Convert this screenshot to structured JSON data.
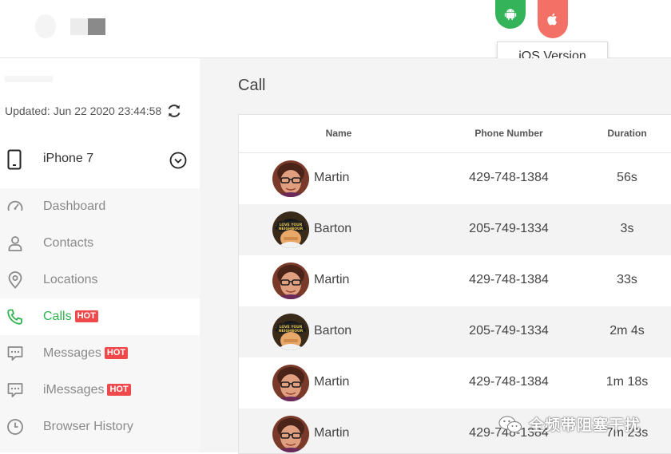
{
  "header": {
    "os_tabs": [
      {
        "name": "android",
        "color": "#34b35a",
        "icon": "android-icon"
      },
      {
        "name": "ios",
        "color": "#f27066",
        "icon": "apple-icon"
      }
    ],
    "tooltip": "iOS Version"
  },
  "sidebar": {
    "updated": "Updated: Jun 22 2020 23:44:58",
    "device": "iPhone 7",
    "nav": [
      {
        "label": "Dashboard",
        "icon": "dashboard-icon",
        "hot": ""
      },
      {
        "label": "Contacts",
        "icon": "contact-icon",
        "hot": ""
      },
      {
        "label": "Locations",
        "icon": "location-pin-icon",
        "hot": ""
      },
      {
        "label": "Calls",
        "icon": "phone-icon",
        "hot": "HOT",
        "active": true
      },
      {
        "label": "Messages",
        "icon": "message-icon",
        "hot": "HOT"
      },
      {
        "label": "iMessages",
        "icon": "message-icon",
        "hot": "HOT"
      },
      {
        "label": "Browser History",
        "icon": "clock-icon",
        "hot": ""
      }
    ],
    "accent": "#2fb350"
  },
  "main": {
    "title": "Call",
    "columns": {
      "name": "Name",
      "phone": "Phone Number",
      "duration": "Duration"
    },
    "rows": [
      {
        "name": "Martin",
        "phone": "429-748-1384",
        "duration": "56s",
        "avatar": "martin"
      },
      {
        "name": "Barton",
        "phone": "205-749-1334",
        "duration": "3s",
        "avatar": "barton"
      },
      {
        "name": "Martin",
        "phone": "429-748-1384",
        "duration": "33s",
        "avatar": "martin"
      },
      {
        "name": "Barton",
        "phone": "205-749-1334",
        "duration": "2m 4s",
        "avatar": "barton"
      },
      {
        "name": "Martin",
        "phone": "429-748-1384",
        "duration": "1m 18s",
        "avatar": "martin"
      },
      {
        "name": "Martin",
        "phone": "429-748-1384",
        "duration": "7m 23s",
        "avatar": "martin"
      }
    ]
  },
  "watermark": "全频带阻塞干扰"
}
